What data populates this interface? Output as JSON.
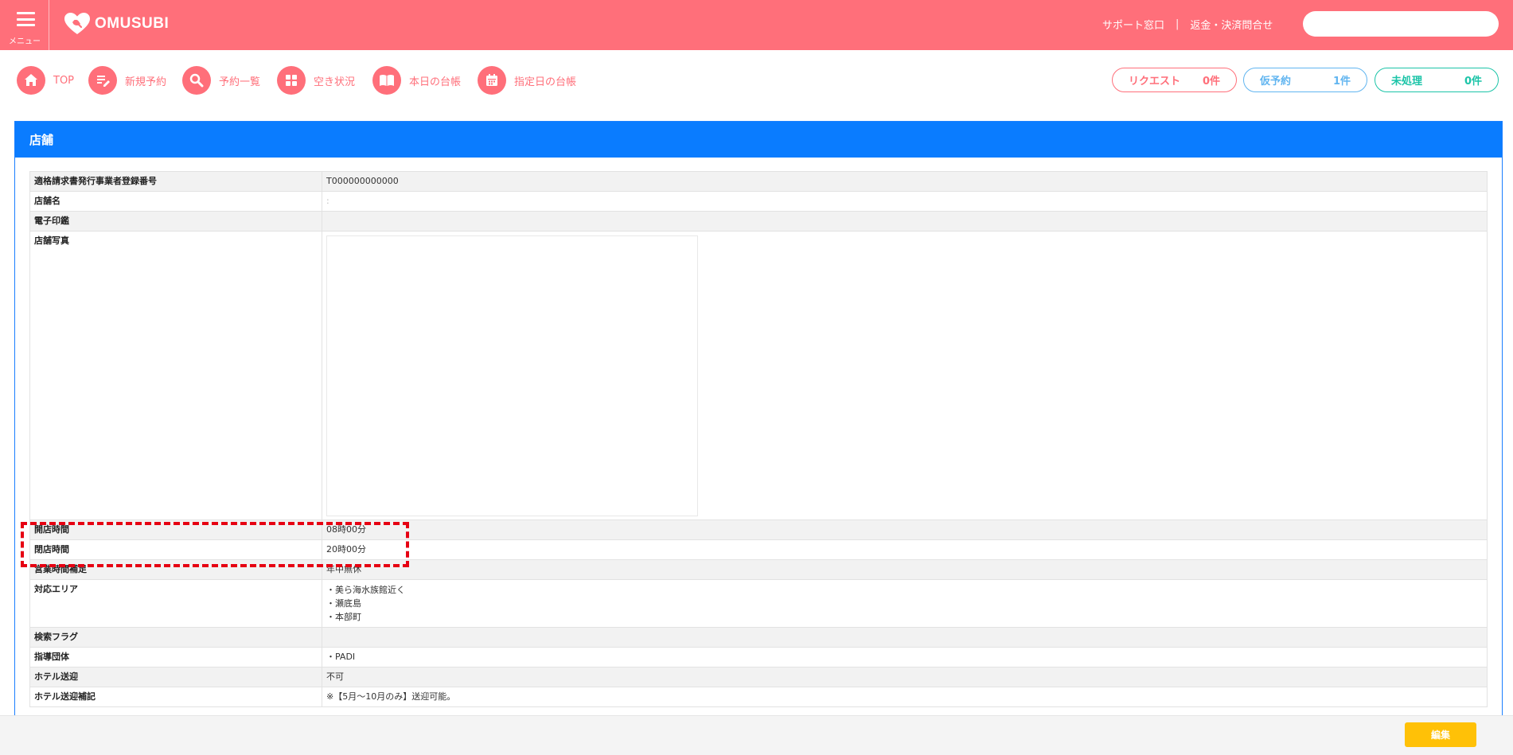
{
  "header": {
    "menu_label": "メニュー",
    "logo_text": "OMUSUBI",
    "support_link": "サポート窓口",
    "separator": "|",
    "refund_link": "返金・決済問合せ",
    "search_placeholder": ""
  },
  "nav": {
    "items": [
      {
        "label": "TOP",
        "icon": "home-icon"
      },
      {
        "label": "新規予約",
        "icon": "edit-icon"
      },
      {
        "label": "予約一覧",
        "icon": "search-icon"
      },
      {
        "label": "空き状況",
        "icon": "grid-icon"
      },
      {
        "label": "本日の台帳",
        "icon": "book-icon"
      },
      {
        "label": "指定日の台帳",
        "icon": "calendar-icon"
      }
    ]
  },
  "status": {
    "request": {
      "label": "リクエスト",
      "count": "0件",
      "color": "#ff6f7a"
    },
    "provisional": {
      "label": "仮予約",
      "count": "1件",
      "color": "#61b5f0"
    },
    "unprocessed": {
      "label": "未処理",
      "count": "0件",
      "color": "#1cc4a8"
    }
  },
  "panel": {
    "title": "店舗",
    "rows": [
      {
        "label": "適格請求書発行事業者登録番号",
        "value": "T000000000000"
      },
      {
        "label": "店舗名",
        "value": ":"
      },
      {
        "label": "電子印鑑",
        "value": ""
      },
      {
        "label": "店舗写真",
        "value": ""
      },
      {
        "label": "開店時間",
        "value": "08時00分"
      },
      {
        "label": "閉店時間",
        "value": "20時00分"
      },
      {
        "label": "営業時間補足",
        "value": "年中無休"
      },
      {
        "label": "対応エリア",
        "values": [
          "・美ら海水族館近く",
          "・瀬底島",
          "・本部町"
        ]
      },
      {
        "label": "検索フラグ",
        "value": ""
      },
      {
        "label": "指導団体",
        "value": "・PADI"
      },
      {
        "label": "ホテル送迎",
        "value": "不可"
      },
      {
        "label": "ホテル送迎補記",
        "value": "※【5月～10月のみ】送迎可能。"
      }
    ]
  },
  "footer": {
    "edit_label": "編集"
  },
  "colors": {
    "header": "#ff6f7a",
    "panel_header": "#0a7cff",
    "edit_button": "#ffc107",
    "highlight": "#e60012"
  }
}
